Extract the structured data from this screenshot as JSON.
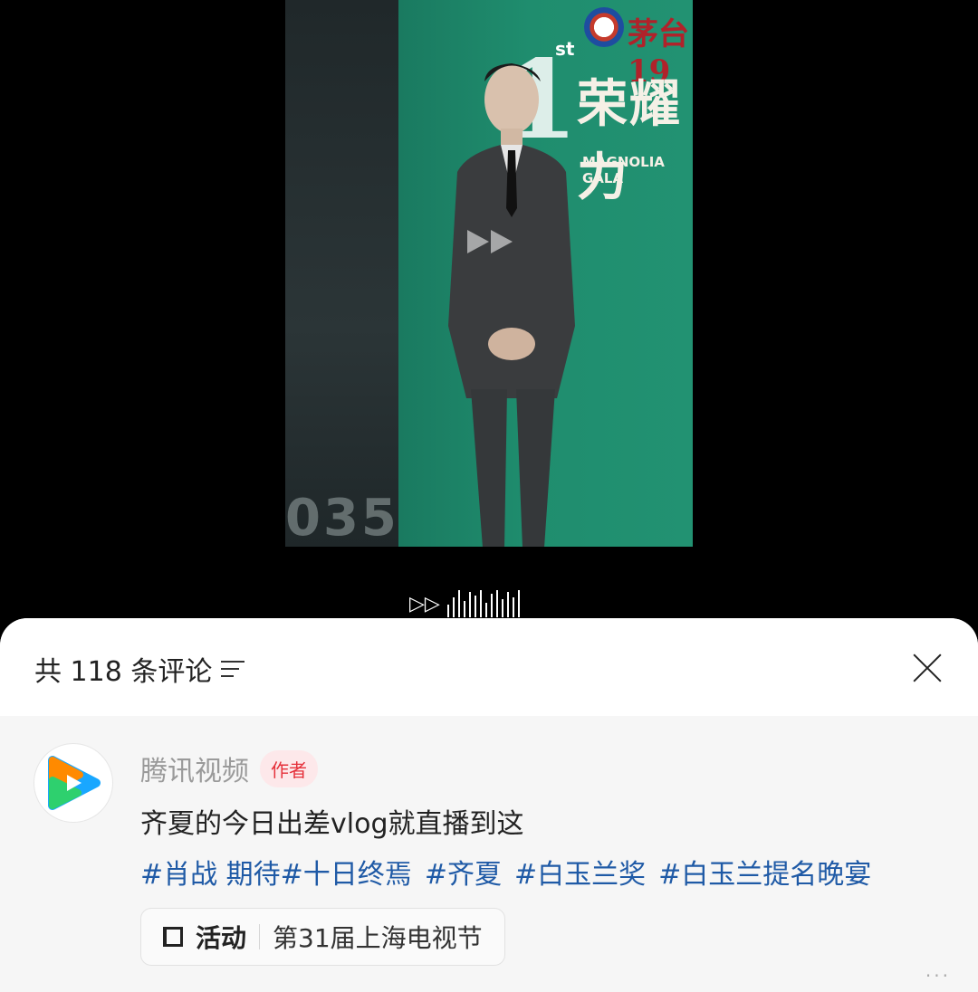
{
  "video": {
    "backdrop_title": "荣耀力",
    "backdrop_subtitle": "MAGNOLIA GALA",
    "backdrop_brand": "茅台19",
    "backdrop_number": "1",
    "backdrop_ordinal": "st",
    "backdrop_bottom": "035",
    "controls": {
      "ff_symbol": "▷▷"
    }
  },
  "comments_sheet": {
    "title": "共 118 条评论",
    "comment": {
      "author": "腾讯视频",
      "badge": "作者",
      "text": "齐夏的今日出差vlog就直播到这",
      "tags": [
        "#肖战 期待#十日终焉",
        "#齐夏",
        "#白玉兰奖",
        "#白玉兰提名晚宴"
      ],
      "activity": {
        "label": "活动",
        "value": "第31届上海电视节"
      }
    }
  },
  "colors": {
    "accent_blue": "#1f5aa6",
    "badge_red": "#e5303a",
    "backdrop_green": "#1f8d6e"
  },
  "icons": {
    "sort": "sort-icon",
    "close": "close-icon",
    "activity": "activity-icon",
    "avatar": "tencent-video-logo-icon",
    "fast_forward": "fast-forward-icon"
  }
}
